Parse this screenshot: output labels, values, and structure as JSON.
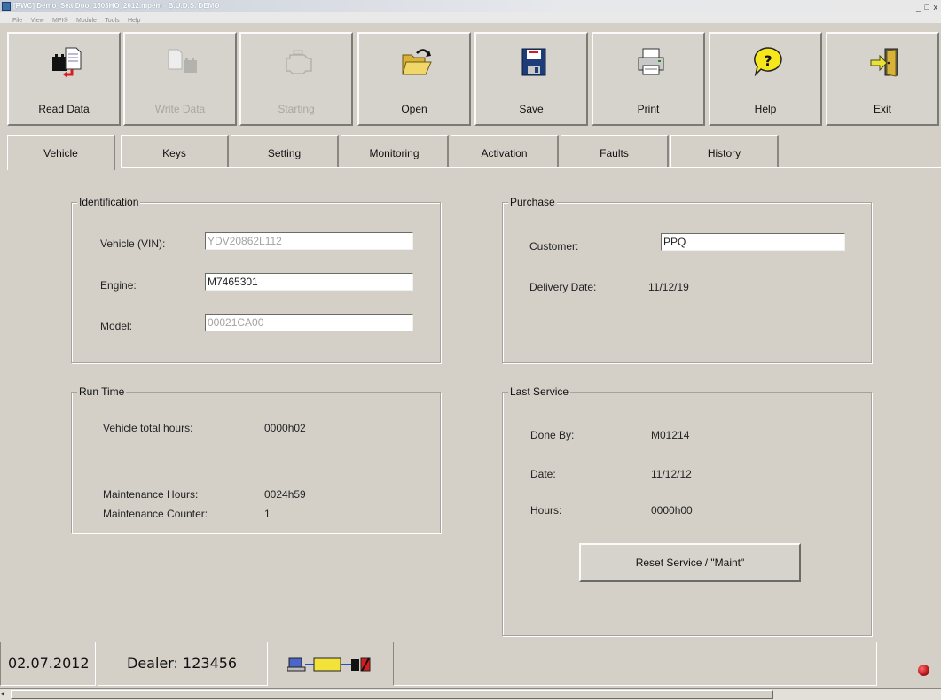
{
  "window": {
    "title": "[PWC] Demo_Sea-Doo_1503HO_2012.mpem - B.U.D.S. DEMO",
    "controls": "_ □ x"
  },
  "menu": [
    "File",
    "View",
    "MPI®",
    "Module",
    "Tools",
    "Help"
  ],
  "toolbar": {
    "read_data": "Read Data",
    "write_data": "Write Data",
    "starting": "Starting",
    "open": "Open",
    "save": "Save",
    "print": "Print",
    "help": "Help",
    "exit": "Exit"
  },
  "tabs": [
    "Vehicle",
    "Keys",
    "Setting",
    "Monitoring",
    "Activation",
    "Faults",
    "History"
  ],
  "identification": {
    "title": "Identification",
    "vin_label": "Vehicle (VIN):",
    "vin_value": "YDV20862L112",
    "engine_label": "Engine:",
    "engine_value": "M7465301",
    "model_label": "Model:",
    "model_value": "00021CA00"
  },
  "purchase": {
    "title": "Purchase",
    "customer_label": "Customer:",
    "customer_value": "PPQ",
    "delivery_label": "Delivery Date:",
    "delivery_value": "11/12/19"
  },
  "run_time": {
    "title": "Run Time",
    "total_label": "Vehicle total hours:",
    "total_value": "0000h02",
    "maint_hours_label": "Maintenance Hours:",
    "maint_hours_value": "0024h59",
    "maint_counter_label": "Maintenance Counter:",
    "maint_counter_value": "1"
  },
  "last_service": {
    "title": "Last Service",
    "done_by_label": "Done By:",
    "done_by_value": "M01214",
    "date_label": "Date:",
    "date_value": "11/12/12",
    "hours_label": "Hours:",
    "hours_value": "0000h00",
    "reset_button": "Reset Service / \"Maint\""
  },
  "status": {
    "date": "02.07.2012",
    "dealer": "Dealer: 123456",
    "indicator_color": "#b3141c"
  }
}
